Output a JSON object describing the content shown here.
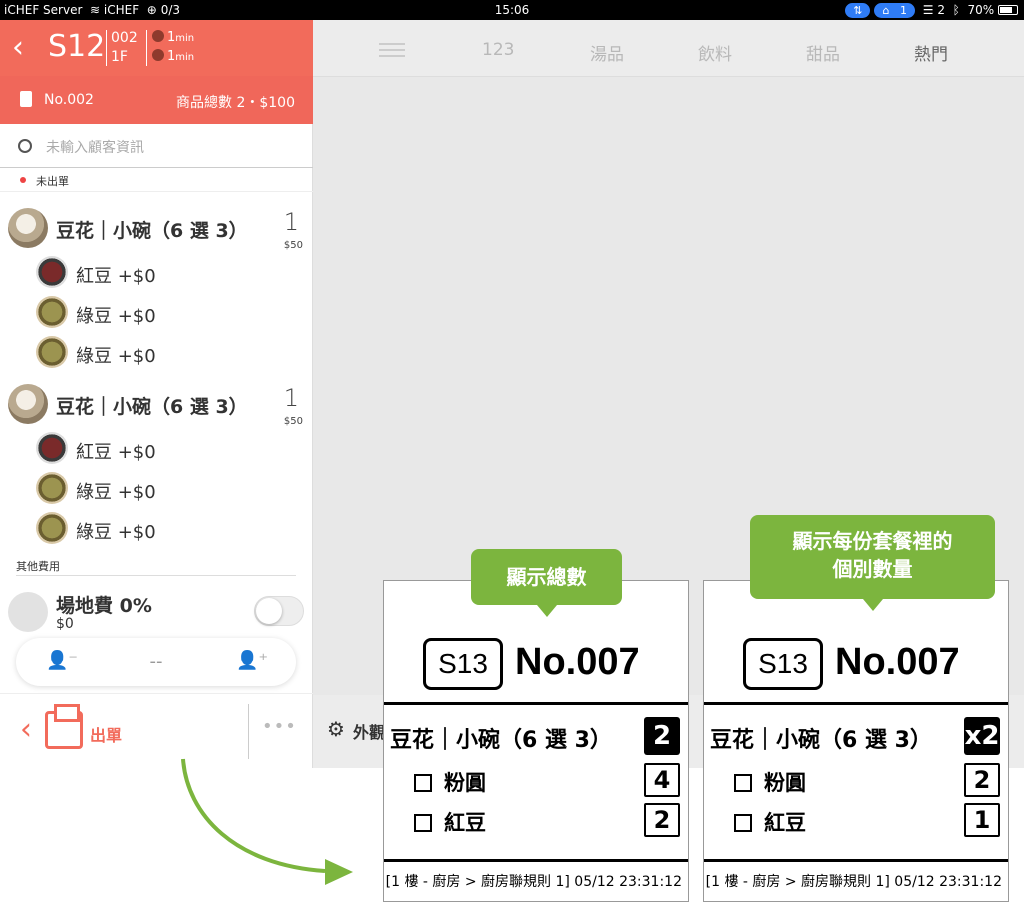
{
  "status_bar": {
    "carrier": "iCHEF Server",
    "wifi_label": "iCHEF",
    "sync": "0/3",
    "time": "15:06",
    "badge_count": "1",
    "tray_count": "2",
    "battery": "70%"
  },
  "order": {
    "table": "S12",
    "order_no_small": "002",
    "floor": "1F",
    "timer1": "1",
    "timer2": "1",
    "timer_unit": "min",
    "order_no": "No.002",
    "summary": "商品總數 2・$100",
    "customer_placeholder": "未輸入顧客資訊",
    "status": "未出單",
    "items": [
      {
        "name": "豆花｜小碗（6 選 3）",
        "qty": "1",
        "price": "$50",
        "subs": [
          "紅豆 +$0",
          "綠豆 +$0",
          "綠豆 +$0"
        ]
      },
      {
        "name": "豆花｜小碗（6 選 3）",
        "qty": "1",
        "price": "$50",
        "subs": [
          "紅豆 +$0",
          "綠豆 +$0",
          "綠豆 +$0"
        ]
      }
    ],
    "other_fees_label": "其他費用",
    "fee_name": "場地費 0%",
    "fee_value": "$0",
    "guest_count": "--",
    "send_label": "出單",
    "more": "•••"
  },
  "menu": {
    "tabs": [
      "123",
      "湯品",
      "飲料",
      "甜品",
      "熱門"
    ],
    "active_tab": "熱門",
    "bottom_label": "外觀"
  },
  "tickets": [
    {
      "bubble": "顯示總數",
      "table": "S13",
      "order_no": "No.007",
      "item": "豆花｜小碗（6 選 3）",
      "item_qty": "2",
      "subs": [
        {
          "name": "粉圓",
          "qty": "4"
        },
        {
          "name": "紅豆",
          "qty": "2"
        }
      ],
      "footer": "[1 樓 - 廚房 > 廚房聯規則 1] 05/12 23:31:12"
    },
    {
      "bubble": "顯示每份套餐裡的個別數量",
      "bubble_line1": "顯示每份套餐裡的",
      "bubble_line2": "個別數量",
      "table": "S13",
      "order_no": "No.007",
      "item": "豆花｜小碗（6 選 3）",
      "item_qty": "x2",
      "subs": [
        {
          "name": "粉圓",
          "qty": "2"
        },
        {
          "name": "紅豆",
          "qty": "1"
        }
      ],
      "footer": "[1 樓 - 廚房 > 廚房聯規則 1] 05/12 23:31:12"
    }
  ],
  "colors": {
    "accent": "#f26b5b",
    "bubble": "#7cb53e",
    "arrow": "#7cb53e"
  }
}
